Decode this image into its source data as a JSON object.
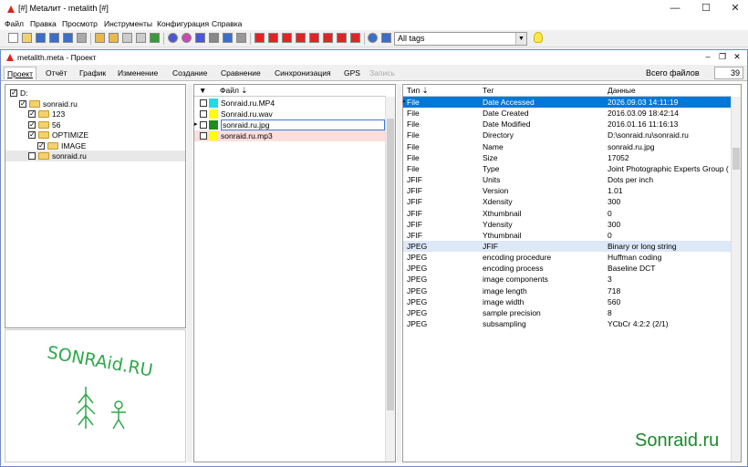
{
  "window": {
    "title": "[#] Metалит - metalith [#]"
  },
  "menu": [
    "Файл",
    "Правка",
    "Просмотр",
    "Инструменты",
    "Конфигурация",
    "Справка"
  ],
  "toolbar": {
    "tags_select": "All tags"
  },
  "inner_window": {
    "title": "metalith.meta - Проект"
  },
  "tabs": [
    "Проект",
    "Отчёт",
    "График",
    "Изменение",
    "Создание",
    "Сравнение",
    "Синхронизация",
    "GPS",
    "Запись"
  ],
  "total": {
    "label": "Всего файлов",
    "count": "39"
  },
  "tree": [
    {
      "label": "D:",
      "level": 0,
      "checked": true
    },
    {
      "label": "sonraid.ru",
      "level": 1,
      "checked": true
    },
    {
      "label": "123",
      "level": 2,
      "checked": true
    },
    {
      "label": "56",
      "level": 2,
      "checked": true
    },
    {
      "label": "OPTIMIZE",
      "level": 2,
      "checked": true
    },
    {
      "label": "IMAGE",
      "level": 3,
      "checked": true
    },
    {
      "label": "sonraid.ru",
      "level": 2,
      "checked": false
    }
  ],
  "signature_text": "SONRAid.RU",
  "files": {
    "header": "Файл ⇣",
    "rows": [
      {
        "name": "Sonraid.ru.MP4",
        "color": "#23d9e8"
      },
      {
        "name": "Sonraid.ru.wav",
        "color": "#ffff00"
      },
      {
        "name": "sonraid.ru.jpg",
        "color": "#1e8c1e"
      },
      {
        "name": "sonraid.ru.mp3",
        "color": "#ffff00"
      }
    ]
  },
  "meta": {
    "headers": {
      "type": "Тип ⇣",
      "tag": "Тег",
      "data": "Данные"
    },
    "rows": [
      {
        "type": "File",
        "tag": "Date Accessed",
        "data": "2026.09.03 14:11:19"
      },
      {
        "type": "File",
        "tag": "Date Created",
        "data": "2016.03.09 18:42:14"
      },
      {
        "type": "File",
        "tag": "Date Modified",
        "data": "2016.01.16 11:16:13"
      },
      {
        "type": "File",
        "tag": "Directory",
        "data": "D:\\sonraid.ru\\sonraid.ru"
      },
      {
        "type": "File",
        "tag": "Name",
        "data": "sonraid.ru.jpg"
      },
      {
        "type": "File",
        "tag": "Size",
        "data": "17052"
      },
      {
        "type": "File",
        "tag": "Type",
        "data": "Joint Photographic Experts Group ("
      },
      {
        "type": "JFIF",
        "tag": "Units",
        "data": "Dots per inch"
      },
      {
        "type": "JFIF",
        "tag": "Version",
        "data": "1.01"
      },
      {
        "type": "JFIF",
        "tag": "Xdensity",
        "data": "300"
      },
      {
        "type": "JFIF",
        "tag": "Xthumbnail",
        "data": "0"
      },
      {
        "type": "JFIF",
        "tag": "Ydensity",
        "data": "300"
      },
      {
        "type": "JFIF",
        "tag": "Ythumbnail",
        "data": "0"
      },
      {
        "type": "JPEG",
        "tag": "JFIF",
        "data": "Binary or long string"
      },
      {
        "type": "JPEG",
        "tag": "encoding procedure",
        "data": "Huffman coding"
      },
      {
        "type": "JPEG",
        "tag": "encoding process",
        "data": "Baseline DCT"
      },
      {
        "type": "JPEG",
        "tag": "image components",
        "data": "3"
      },
      {
        "type": "JPEG",
        "tag": "image length",
        "data": "718"
      },
      {
        "type": "JPEG",
        "tag": "image width",
        "data": "560"
      },
      {
        "type": "JPEG",
        "tag": "sample precision",
        "data": "8"
      },
      {
        "type": "JPEG",
        "tag": "subsampling",
        "data": "YCbCr 4:2:2 (2/1)"
      }
    ]
  },
  "watermark": "Sonraid.ru"
}
